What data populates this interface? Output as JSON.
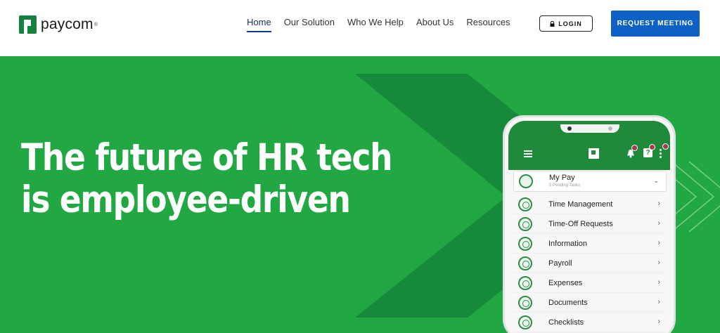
{
  "brand": {
    "name": "paycom",
    "reg": "®",
    "color": "#168040"
  },
  "nav": [
    {
      "label": "Home",
      "active": true
    },
    {
      "label": "Our Solution"
    },
    {
      "label": "Who We Help"
    },
    {
      "label": "About Us"
    },
    {
      "label": "Resources"
    }
  ],
  "header": {
    "login_label": "LOGIN",
    "request_label": "REQUEST MEETING",
    "request_color": "#0d61c6"
  },
  "hero": {
    "line1": "The future of HR tech",
    "line2": "is employee-driven",
    "bg_color": "#22a843"
  },
  "phone": {
    "mypay": {
      "label": "My Pay",
      "sub": "5 Pending Tasks"
    },
    "menu": [
      {
        "label": "Time Management",
        "icon": "clock-icon"
      },
      {
        "label": "Time-Off Requests",
        "icon": "calendar-icon"
      },
      {
        "label": "Information",
        "icon": "info-icon"
      },
      {
        "label": "Payroll",
        "icon": "dollar-icon"
      },
      {
        "label": "Expenses",
        "icon": "card-icon"
      },
      {
        "label": "Documents",
        "icon": "document-icon"
      },
      {
        "label": "Checklists",
        "icon": "checklist-icon"
      }
    ]
  }
}
